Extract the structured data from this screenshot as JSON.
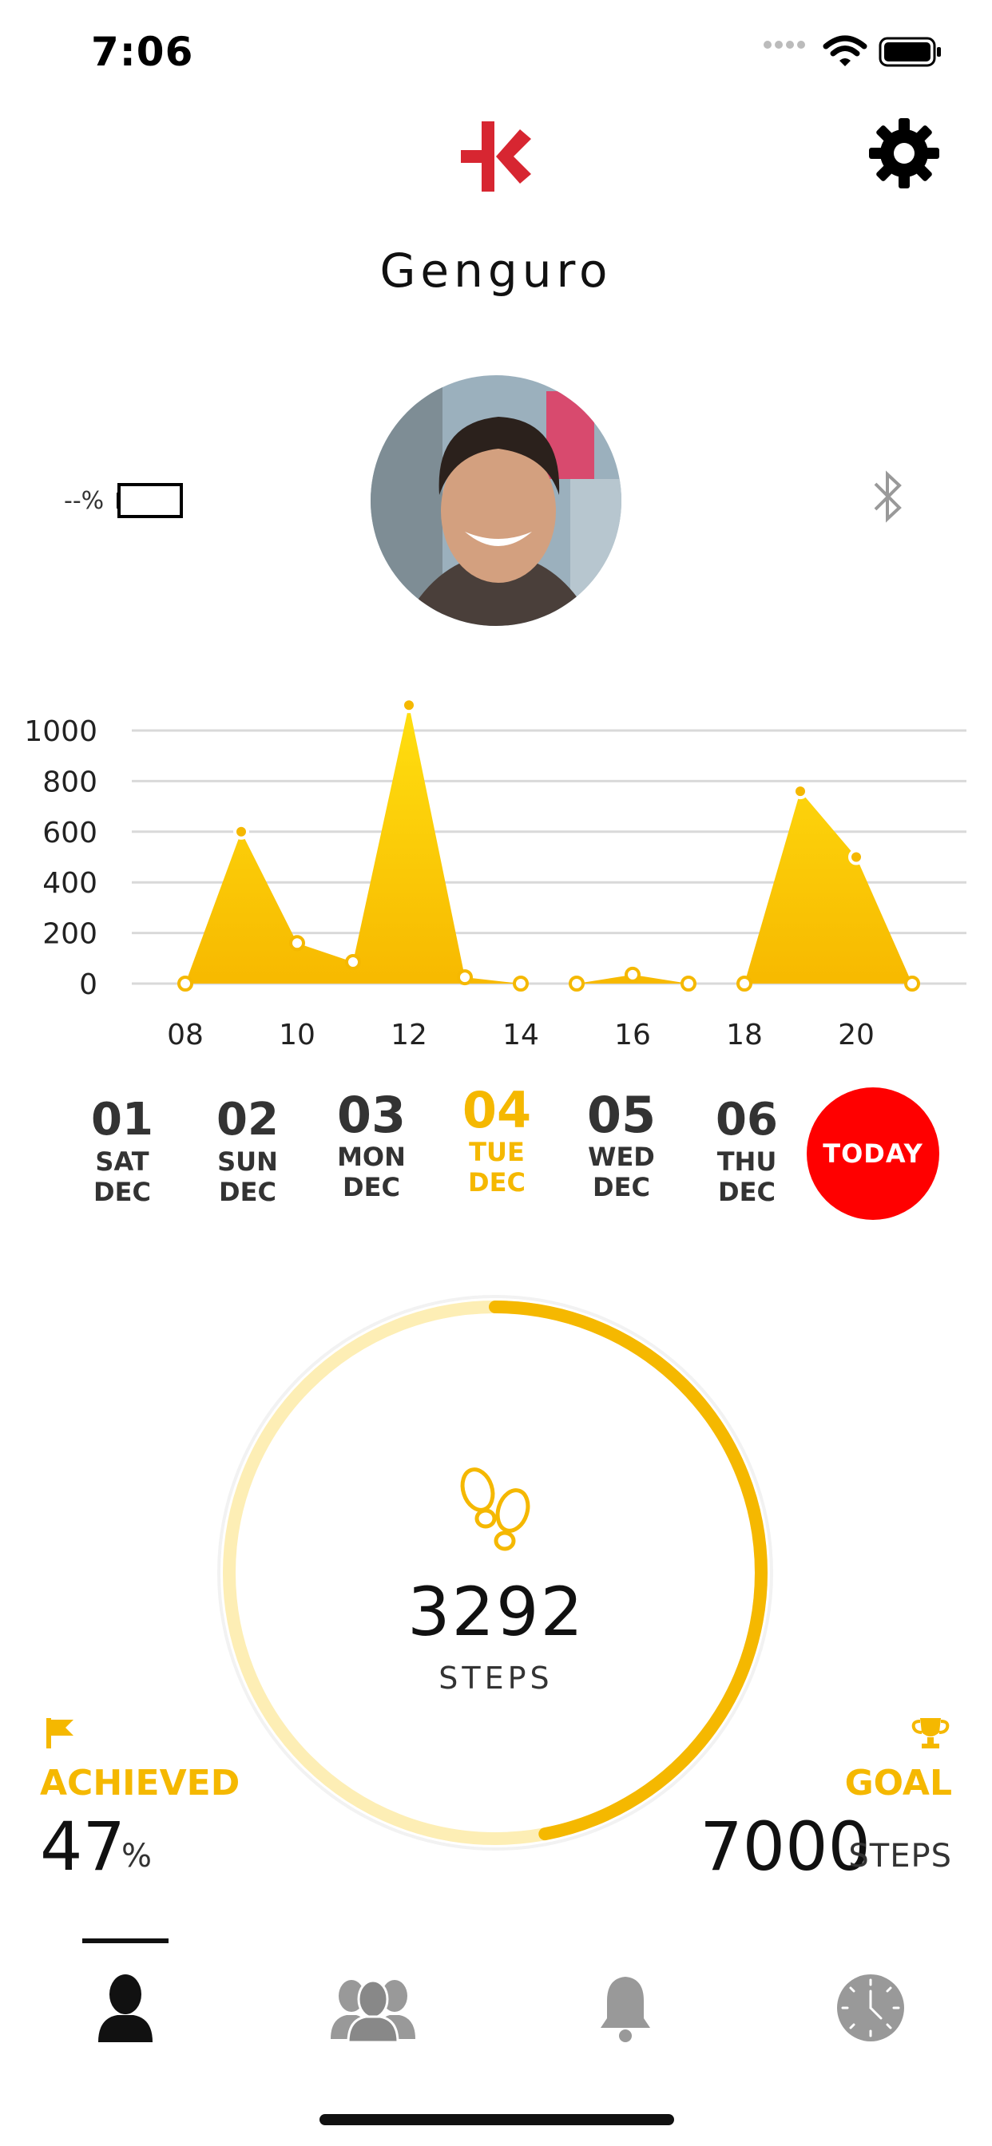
{
  "status_bar": {
    "time": "7:06"
  },
  "header": {
    "username": "Genguro"
  },
  "device": {
    "battery_text": "--%"
  },
  "chart_data": {
    "type": "area",
    "x": [
      8,
      9,
      10,
      11,
      12,
      13,
      14,
      15,
      16,
      17,
      18,
      19,
      20,
      21
    ],
    "values": [
      0,
      600,
      160,
      85,
      1100,
      25,
      0,
      0,
      35,
      0,
      0,
      760,
      500,
      0
    ],
    "xticks": [
      "08",
      "10",
      "12",
      "14",
      "16",
      "18",
      "20"
    ],
    "yticks": [
      "0",
      "200",
      "400",
      "600",
      "800",
      "1000"
    ],
    "ylim": [
      0,
      1000
    ],
    "grid": true,
    "color": "#fdd20c"
  },
  "dates": [
    {
      "num": "01",
      "dow": "SAT",
      "mon": "DEC"
    },
    {
      "num": "02",
      "dow": "SUN",
      "mon": "DEC"
    },
    {
      "num": "03",
      "dow": "MON",
      "mon": "DEC"
    },
    {
      "num": "04",
      "dow": "TUE",
      "mon": "DEC"
    },
    {
      "num": "05",
      "dow": "WED",
      "mon": "DEC"
    },
    {
      "num": "06",
      "dow": "THU",
      "mon": "DEC"
    }
  ],
  "today_button": "TODAY",
  "steps": {
    "count": "3292",
    "label": "STEPS",
    "progress": 0.47
  },
  "achieved": {
    "label": "ACHIEVED",
    "value": "47",
    "unit": "%"
  },
  "goal": {
    "label": "GOAL",
    "value": "7000",
    "unit": "STEPS"
  },
  "colors": {
    "accent": "#f5b800",
    "today": "#ff0000",
    "ring_track": "#fdeeb5"
  },
  "nav": {
    "tabs": [
      "profile-icon",
      "group-icon",
      "bell-icon",
      "clock-icon"
    ],
    "active": 0
  }
}
